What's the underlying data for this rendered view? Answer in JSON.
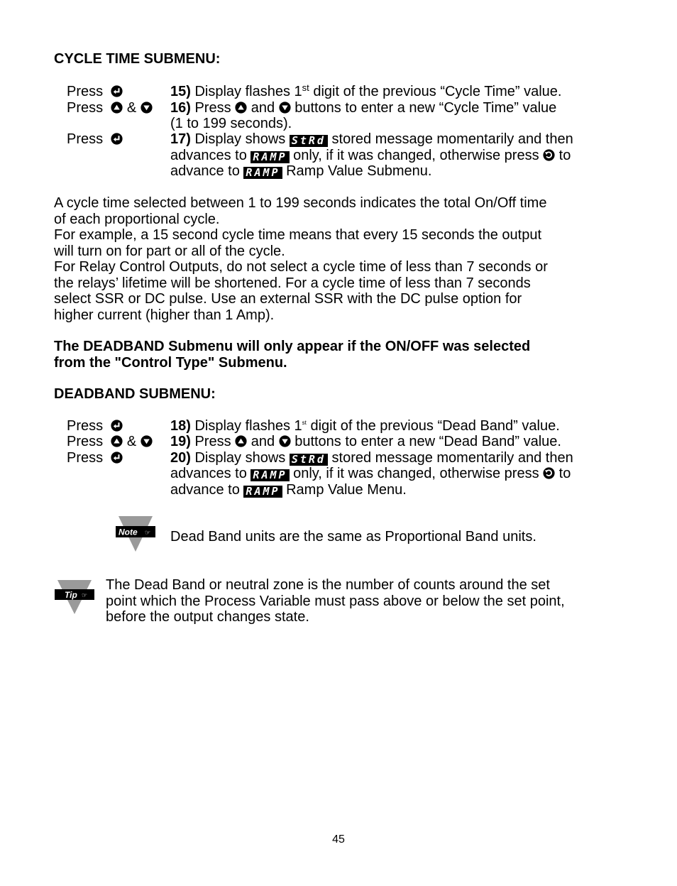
{
  "cycle_time": {
    "heading": "CYCLE TIME SUBMENU:",
    "steps": [
      {
        "press": "Press",
        "keys": [
          "enter"
        ],
        "num": "15)",
        "text_a": " Display flashes 1",
        "sup": "st",
        "text_b": " digit of the previous “Cycle Time” value."
      },
      {
        "press": "Press",
        "keys": [
          "up",
          "down"
        ],
        "amp": "&",
        "num": "16)",
        "text_a": " Press ",
        "and": " and ",
        "text_b": " buttons to enter a new “Cycle Time” value",
        "cont": "(1 to 199 seconds)."
      },
      {
        "press": "Press",
        "keys": [
          "enter"
        ],
        "num": "17)",
        "text_a": " Display shows ",
        "lcd1": "StRd",
        "text_b": " stored message momentarily and then",
        "line2_a": "advances to ",
        "lcd2": "RAMP",
        "line2_b": " only, if it was changed, otherwise press ",
        "line2_c": " to",
        "line3_a": "advance to ",
        "lcd3": "RAMP",
        "line3_b": " Ramp Value Submenu."
      }
    ],
    "paragraph": [
      "A cycle time selected between 1 to 199 seconds indicates the total On/Off time",
      "of each proportional cycle.",
      "For example, a 15 second cycle time means that every 15 seconds the output",
      "will turn on for part or all of the cycle.",
      "For Relay Control Outputs, do not select a cycle time of less than 7 seconds or",
      "the relays’ lifetime will be shortened. For a cycle time of less than 7 seconds",
      "select SSR or DC pulse. Use an external SSR with the DC pulse option for",
      "higher current (higher than 1 Amp)."
    ]
  },
  "deadband_notice": [
    "The DEADBAND Submenu will only appear if the ON/OFF was selected",
    "from the \"Control Type\" Submenu."
  ],
  "deadband": {
    "heading": "DEADBAND SUBMENU:",
    "steps": [
      {
        "press": "Press",
        "num": "18)",
        "text_a": " Display flashes 1",
        "sup": "st",
        "text_b": " digit of the previous “Dead Band” value."
      },
      {
        "press": "Press",
        "amp": "&",
        "num": "19)",
        "text_a": " Press ",
        "and": " and ",
        "text_b": " buttons to enter a new “Dead Band” value."
      },
      {
        "press": "Press",
        "num": "20)",
        "text_a": " Display shows ",
        "lcd1": "StRd",
        "text_b": " stored message momentarily and then",
        "line2_a": "advances to ",
        "lcd2": "RAMP",
        "line2_b": " only, if it was changed, otherwise press ",
        "line2_c": " to",
        "line3_a": "advance to ",
        "lcd3": "RAMP",
        "line3_b": " Ramp Value Menu."
      }
    ]
  },
  "note": {
    "label": "Note",
    "text": "Dead Band units are the same as Proportional Band units."
  },
  "tip": {
    "label": "Tip",
    "lines": [
      "The Dead Band or neutral zone is the number of counts around the set",
      "point which the Process Variable must pass above or below the set point,",
      "before the output changes state."
    ]
  },
  "page_number": "45"
}
